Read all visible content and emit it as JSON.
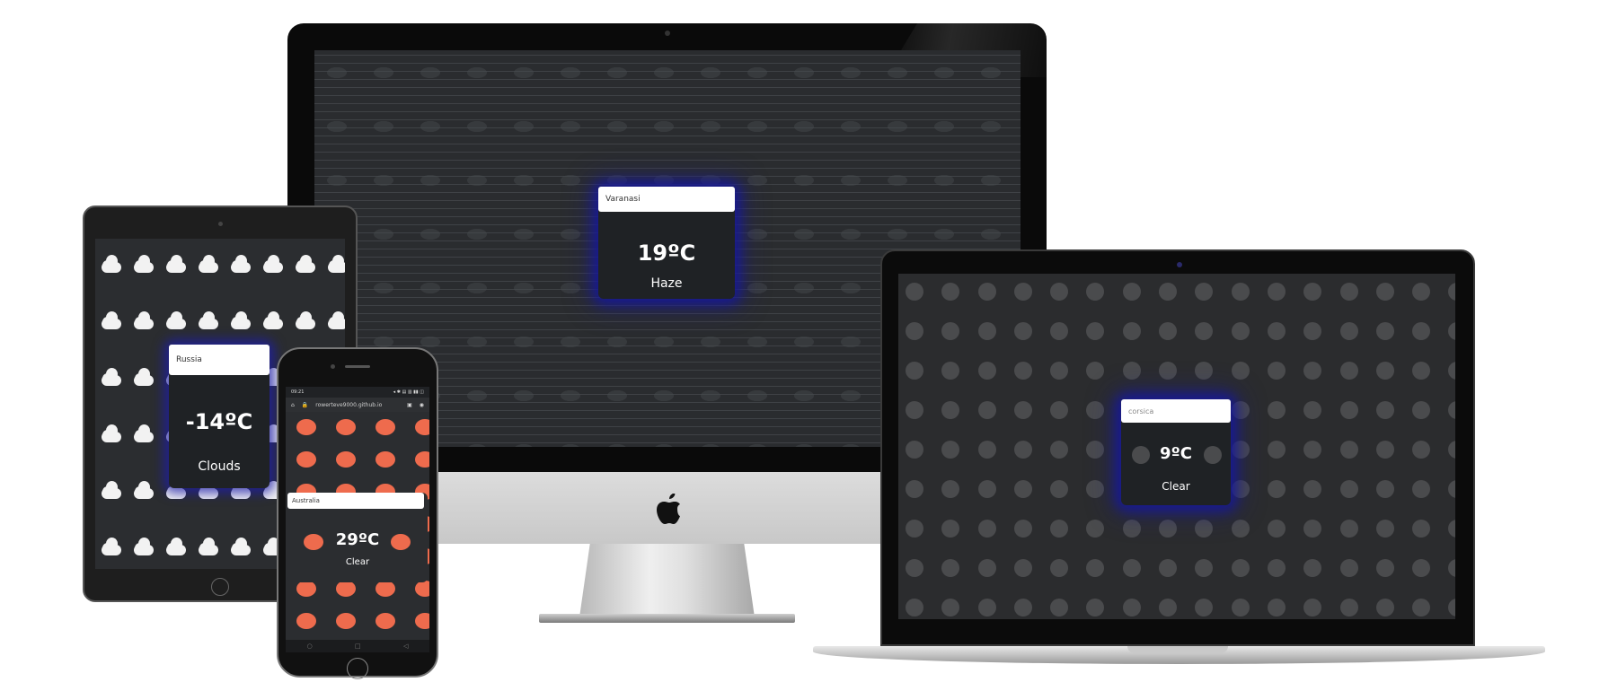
{
  "imac": {
    "search_value": "Varanasi",
    "temperature": "19ºC",
    "condition": "Haze"
  },
  "ipad": {
    "search_value": "Russia",
    "temperature": "-14ºC",
    "condition": "Clouds"
  },
  "phone": {
    "status_time": "09:21",
    "status_icons": "◂ ✱ ▤ ▥ ▮▮ ◫",
    "url": "rowerteve9000.github.io",
    "search_value": "Australia",
    "temperature": "29ºC",
    "condition": "Clear",
    "nav_items": [
      "○",
      "□",
      "◁"
    ]
  },
  "macbook": {
    "search_value": "corsica",
    "temperature": "9ºC",
    "condition": "Clear"
  },
  "colors": {
    "glow": "#1414a0",
    "orange_dot": "#ee6b4d",
    "grey_dot": "#4a4b4d"
  },
  "icons": [
    "apple-logo-icon",
    "lock-icon",
    "home-icon",
    "tab-icon",
    "eye-icon",
    "cloud-icon"
  ]
}
